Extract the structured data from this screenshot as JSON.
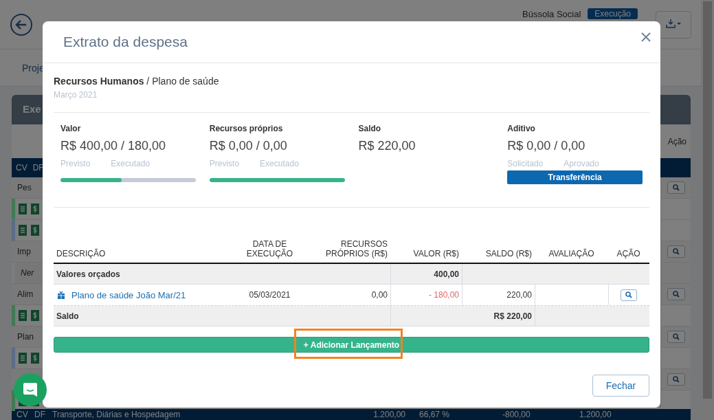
{
  "page": {
    "brand_label": "Bússola Social",
    "status_badge": "Execução",
    "nav_tab": "Proje",
    "card_tab": "Exe",
    "action_column": "Ação",
    "header_cells": [
      "CV",
      "DF"
    ],
    "rows": [
      {
        "kind": "group",
        "label": "Pes",
        "italic": false,
        "search": true
      },
      {
        "kind": "icons",
        "color": "#417a55"
      },
      {
        "kind": "icons",
        "color": "#5c6b88"
      },
      {
        "kind": "group",
        "label": "Imp",
        "italic": false,
        "search": true
      },
      {
        "kind": "group",
        "label": "Ner",
        "italic": true,
        "search": false,
        "color": "#7d7d7d"
      },
      {
        "kind": "group",
        "label": "Alim",
        "italic": false,
        "search": true
      },
      {
        "kind": "icons",
        "color": "#417a55"
      },
      {
        "kind": "group",
        "label": "Plan",
        "italic": false,
        "search": true
      },
      {
        "kind": "icons",
        "color": "#5c6b88"
      },
      {
        "kind": "group",
        "search": true
      },
      {
        "kind": "icons",
        "color": "#417a55"
      }
    ],
    "footer_row": [
      "CV",
      "DF",
      "Transporte, Diárias e Hospedagem",
      "1.200,00",
      "66,67 %",
      "-800,00",
      "1.200,00"
    ]
  },
  "modal": {
    "title": "Extrato da despesa",
    "category": "Recursos Humanos",
    "subcategory": "/ Plano de saúde",
    "period": "Março 2021",
    "stats": [
      {
        "kind": "bar",
        "label": "Valor",
        "value": "R$ 400,00 / 180,00",
        "sublabels": [
          "Previsto",
          "Executado"
        ],
        "level": 0.45
      },
      {
        "kind": "bar",
        "label": "Recursos próprios",
        "value": "R$ 0,00 / 0,00",
        "sublabels": [
          "Previsto",
          "Executado"
        ],
        "level": 1
      },
      {
        "kind": "plain",
        "label": "Saldo",
        "value": "R$ 220,00"
      },
      {
        "kind": "button",
        "label": "Aditivo",
        "value": "R$ 0,00 / 0,00",
        "sublabels": [
          "Solicitado",
          "Aprovado"
        ],
        "button": "Transferência"
      }
    ],
    "columns": [
      "DESCRIÇÃO",
      "DATA DE EXECUÇÃO",
      "RECURSOS PRÓPRIOS (R$)",
      "VALOR (R$)",
      "SALDO (R$)",
      "AVALIAÇÃO",
      "AÇÃO"
    ],
    "rows": [
      {
        "kind": "budget",
        "label": "Valores orçados",
        "value": "400,00"
      },
      {
        "kind": "entry",
        "description": "Plano de saúde João Mar/21",
        "date": "05/03/2021",
        "own": "0,00",
        "value": "- 180,00",
        "balance": "220,00"
      },
      {
        "kind": "total",
        "label": "Saldo",
        "value": "R$ 220,00"
      }
    ],
    "add_button": "Adicionar Lançamento",
    "add_icon": "+",
    "highlighted": true,
    "close_button": "Fechar"
  }
}
